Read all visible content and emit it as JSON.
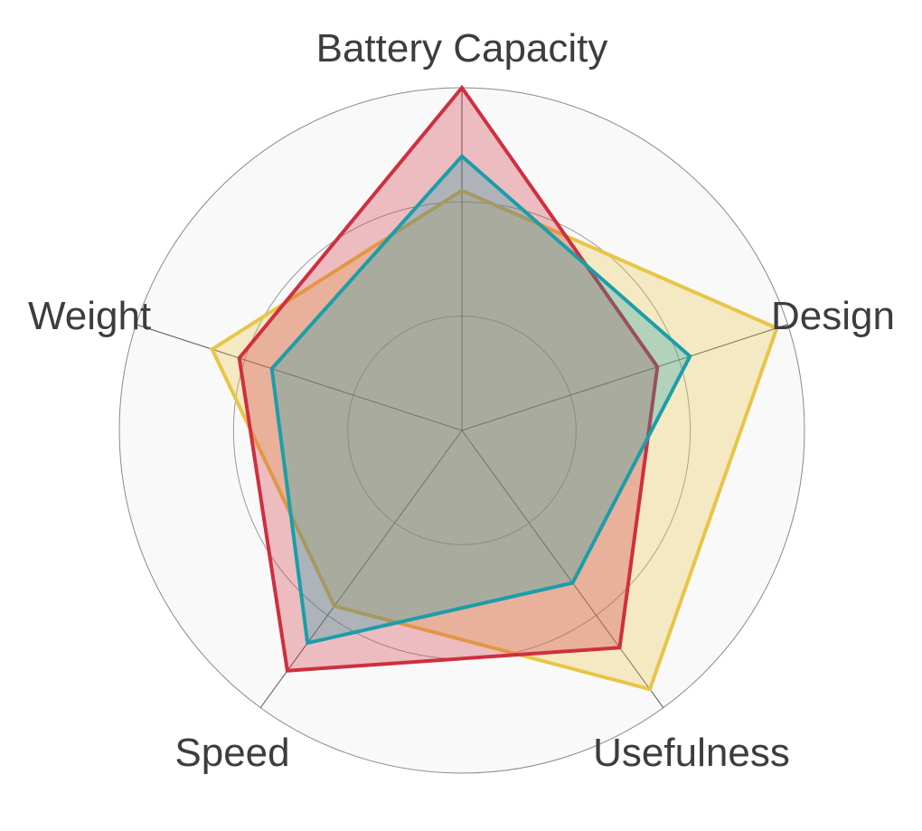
{
  "chart_data": {
    "type": "radar",
    "axes": [
      "Battery Capacity",
      "Design",
      "Usefulness",
      "Speed",
      "Weight"
    ],
    "rlim": [
      0,
      6
    ],
    "grid_rings": [
      2,
      4,
      6
    ],
    "grid": true,
    "legend": "none",
    "series": [
      {
        "values": [
          4.2,
          5.8,
          5.6,
          3.8,
          4.6
        ],
        "color": "#E8C547",
        "fill_opacity": 0.3
      },
      {
        "values": [
          6.0,
          3.6,
          4.7,
          5.2,
          4.1
        ],
        "color": "#CF2F3F",
        "fill_opacity": 0.3
      },
      {
        "values": [
          4.8,
          4.2,
          3.3,
          4.6,
          3.5
        ],
        "color": "#1B9EA8",
        "fill_opacity": 0.3
      }
    ]
  },
  "background": {
    "plot_bg": "#F9F9F9",
    "grid_color": "#9A9A9A"
  }
}
